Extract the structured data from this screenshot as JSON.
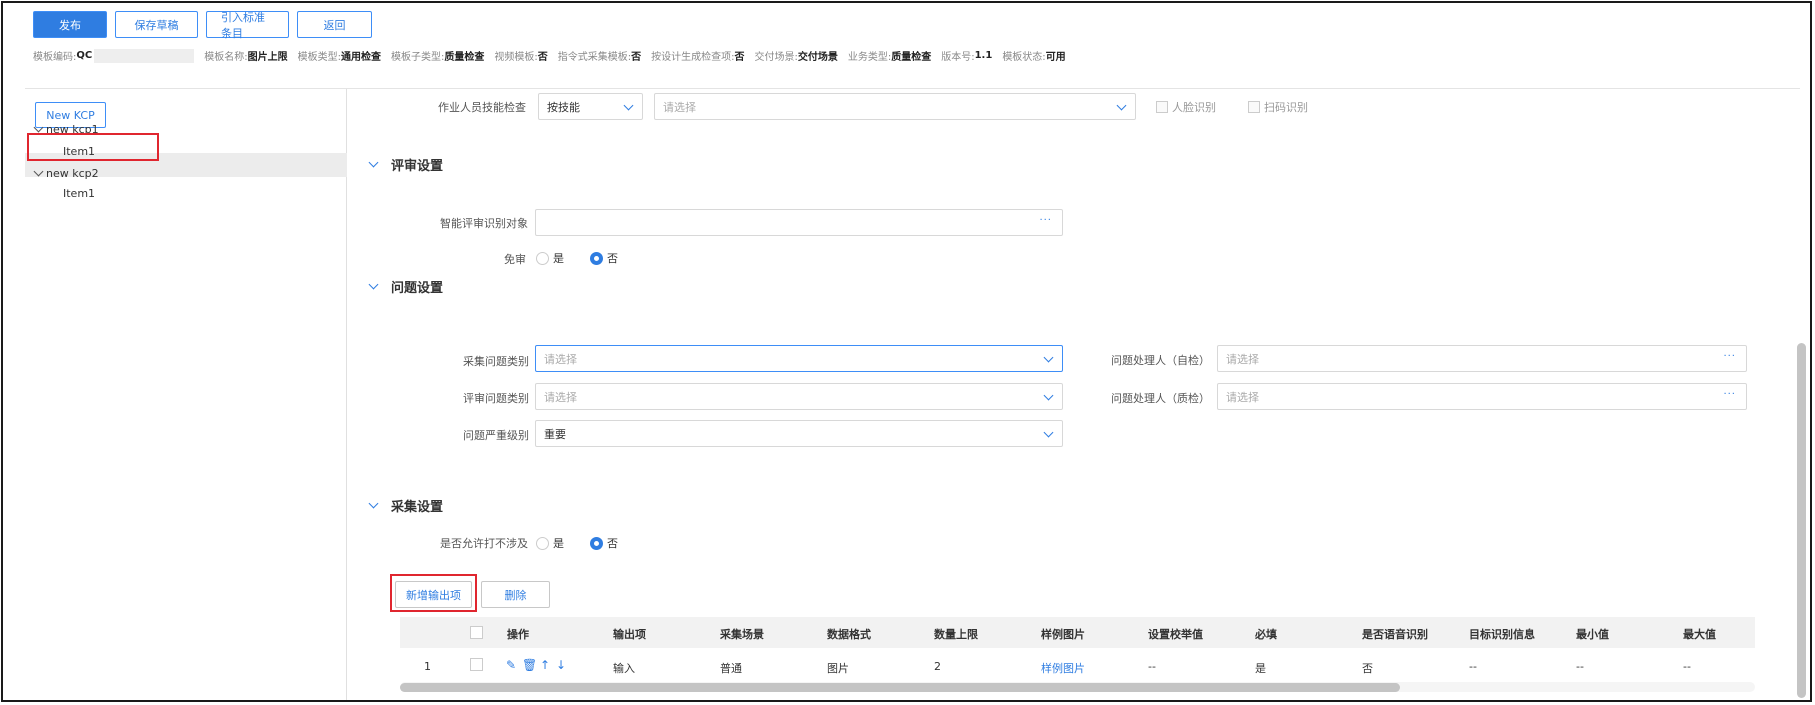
{
  "toolbar": {
    "publish": "发布",
    "save_draft": "保存草稿",
    "import_standard": "引入标准条目",
    "back": "返回"
  },
  "meta": {
    "code_label": "模板编码:",
    "code_value": "QC",
    "name_label": "模板名称:",
    "name_value": "图片上限",
    "type_label": "模板类型:",
    "type_value": "通用检查",
    "subtype_label": "模板子类型:",
    "subtype_value": "质量检查",
    "video_label": "视频模板:",
    "video_value": "否",
    "cmd_label": "指令式采集模板:",
    "cmd_value": "否",
    "design_label": "按设计生成检查项:",
    "design_value": "否",
    "scene_label": "交付场景:",
    "scene_value": "交付场景",
    "biz_label": "业务类型:",
    "biz_value": "质量检查",
    "ver_label": "版本号:",
    "ver_value": "1.1",
    "status_label": "模板状态:",
    "status_value": "可用"
  },
  "left": {
    "new_kcp": "New KCP",
    "tree": [
      {
        "label": "new kcp1",
        "children": [
          "Item1"
        ]
      },
      {
        "label": "new kcp2",
        "children": [
          "Item1"
        ]
      }
    ]
  },
  "skill": {
    "label": "作业人员技能检查",
    "mode": "按技能",
    "placeholder": "请选择",
    "face": "人脸识别",
    "scan": "扫码识别"
  },
  "review": {
    "title": "评审设置",
    "smart_label": "智能评审识别对象",
    "smart_dots": "···",
    "exempt_label": "免审",
    "yes": "是",
    "no": "否"
  },
  "issue": {
    "title": "问题设置",
    "collect_type_label": "采集问题类别",
    "review_type_label": "评审问题类别",
    "severity_label": "问题严重级别",
    "severity_value": "重要",
    "handler_self_label": "问题处理人（自检）",
    "handler_qc_label": "问题处理人（质检）",
    "placeholder": "请选择",
    "dots": "···"
  },
  "collect": {
    "title": "采集设置",
    "allow_label": "是否允许打不涉及",
    "yes": "是",
    "no": "否",
    "add_output": "新增输出项",
    "delete": "删除"
  },
  "table": {
    "headers": [
      "操作",
      "输出项",
      "采集场景",
      "数据格式",
      "数量上限",
      "样例图片",
      "设置校举值",
      "必填",
      "是否语音识别",
      "目标识别信息",
      "最小值",
      "最大值"
    ],
    "rows": [
      {
        "index": "1",
        "output": "输入",
        "scene": "普通",
        "format": "图片",
        "limit": "2",
        "sample": "样例图片",
        "enum": "--",
        "required": "是",
        "voice": "否",
        "target": "--",
        "min": "--",
        "max": "--"
      }
    ]
  }
}
